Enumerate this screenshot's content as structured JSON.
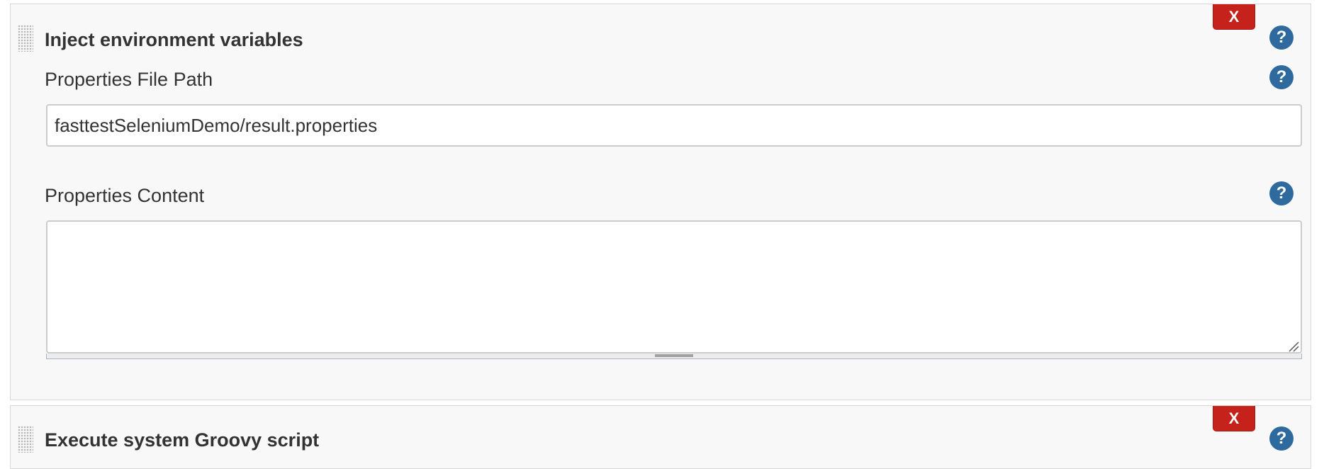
{
  "sections": [
    {
      "title": "Inject environment variables",
      "delete_label": "X",
      "help_label": "?",
      "fields": {
        "file_path": {
          "label": "Properties File Path",
          "value": "fasttestSeleniumDemo/result.properties",
          "help_label": "?"
        },
        "content": {
          "label": "Properties Content",
          "value": "",
          "help_label": "?"
        }
      }
    },
    {
      "title": "Execute system Groovy script",
      "delete_label": "X",
      "help_label": "?"
    }
  ],
  "colors": {
    "delete_button": "#c4221b",
    "help_icon": "#2e6a9e",
    "section_background": "#f8f8f8"
  },
  "icons": {
    "drag_handle": "drag-handle-icon",
    "help": "question-mark-icon"
  }
}
